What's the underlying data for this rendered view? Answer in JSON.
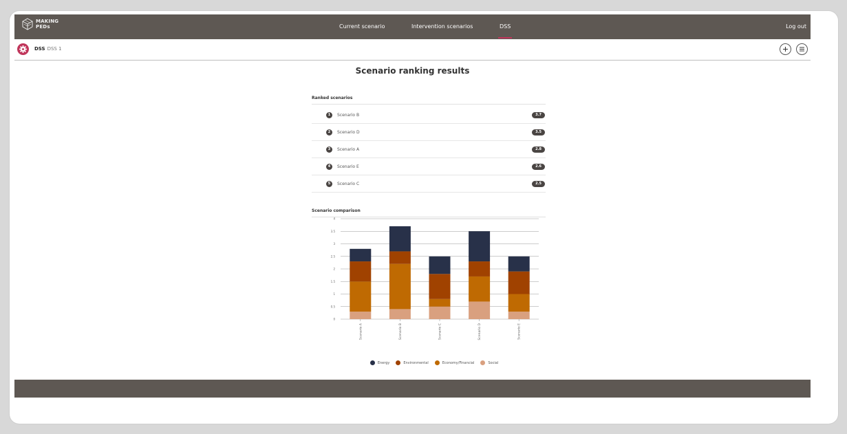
{
  "app": {
    "logo_line1": "MAKING",
    "logo_line2": "PEDs"
  },
  "nav": {
    "items": [
      {
        "label": "Current scenario",
        "active": false
      },
      {
        "label": "Intervention scenarios",
        "active": false
      },
      {
        "label": "DSS",
        "active": true
      }
    ],
    "logout": "Log out"
  },
  "subheader": {
    "title": "DSS",
    "subtitle": "DSS 1"
  },
  "page": {
    "title": "Scenario ranking results"
  },
  "ranking": {
    "heading": "Ranked scenarios",
    "items": [
      {
        "rank": "1",
        "name": "Scenario B",
        "score": "3.7"
      },
      {
        "rank": "2",
        "name": "Scenario D",
        "score": "3.5"
      },
      {
        "rank": "3",
        "name": "Scenario A",
        "score": "2.8"
      },
      {
        "rank": "4",
        "name": "Scenario E",
        "score": "2.6"
      },
      {
        "rank": "5",
        "name": "Scenario C",
        "score": "2.5"
      }
    ]
  },
  "comparison": {
    "heading": "Scenario comparison"
  },
  "colors": {
    "header_bg": "#5e5853",
    "accent": "#c0365b",
    "badge": "#4a4543"
  },
  "chart_data": {
    "type": "bar",
    "stacked": true,
    "categories": [
      "Scenario A",
      "Scenario B",
      "Scenario C",
      "Scenario D",
      "Scenario E"
    ],
    "series": [
      {
        "name": "Social",
        "color": "#d9a07f",
        "values": [
          0.3,
          0.4,
          0.5,
          0.7,
          0.3
        ]
      },
      {
        "name": "Economy/Financial",
        "color": "#bf6a02",
        "values": [
          1.2,
          1.8,
          0.3,
          1.0,
          0.7
        ]
      },
      {
        "name": "Environmental",
        "color": "#a04200",
        "values": [
          0.8,
          0.5,
          1.0,
          0.6,
          0.9
        ]
      },
      {
        "name": "Energy",
        "color": "#283149",
        "values": [
          0.5,
          1.0,
          0.7,
          1.2,
          0.6
        ]
      }
    ],
    "legend_order": [
      "Energy",
      "Environmental",
      "Economy/Financial",
      "Social"
    ],
    "yticks": [
      "0",
      "0.5",
      "1",
      "1.5",
      "2",
      "2.5",
      "3",
      "3.5",
      "4"
    ],
    "ylim": [
      0,
      4
    ],
    "grid": true,
    "legend": "bottom"
  }
}
